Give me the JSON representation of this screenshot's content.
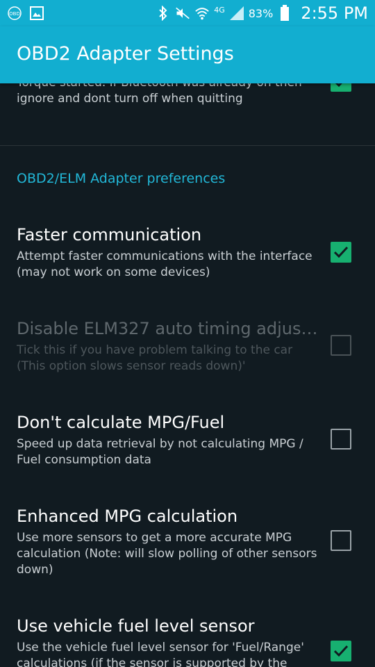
{
  "status_bar": {
    "left_icons": [
      "obd-icon",
      "image-icon"
    ],
    "obd_icon_text": "OBD",
    "network_label": "4G",
    "battery_percent": "83%",
    "time": "2:55 PM"
  },
  "app_bar": {
    "title": "OBD2 Adapter Settings"
  },
  "colors": {
    "accent": "#12aed0",
    "checkbox_on": "#17b070",
    "background": "#111b21",
    "category": "#22b8d8"
  },
  "top_pref": {
    "summary_visible": "Only turns on, on Bluetooth if it was off when Torque started. If Bluetooth was already on then ignore and dont turn off when quitting",
    "checked": true
  },
  "category": {
    "label": "OBD2/ELM Adapter preferences"
  },
  "preferences": [
    {
      "title": "Faster communication",
      "summary": "Attempt faster communications with the interface (may not work on some devices)",
      "checked": true,
      "enabled": true
    },
    {
      "title": "Disable ELM327 auto timing adjust(..",
      "summary": "Tick this if you have problem talking to the car (This option slows sensor reads down)'",
      "checked": false,
      "enabled": false
    },
    {
      "title": "Don't calculate MPG/Fuel",
      "summary": "Speed up data retrieval by not calculating MPG / Fuel consumption data",
      "checked": false,
      "enabled": true
    },
    {
      "title": "Enhanced MPG calculation",
      "summary": "Use more sensors to get a more accurate MPG calculation (Note: will slow polling of other sensors down)",
      "checked": false,
      "enabled": true
    },
    {
      "title": "Use vehicle fuel level sensor",
      "summary": "Use the vehicle fuel level sensor for 'Fuel/Range' calculations (if the sensor is supported by the",
      "checked": true,
      "enabled": true
    }
  ]
}
